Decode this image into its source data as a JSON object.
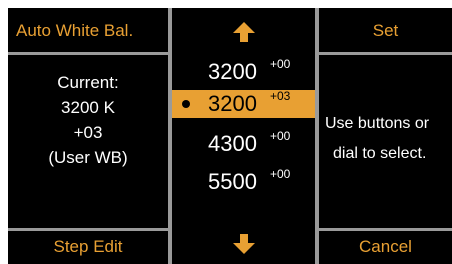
{
  "left": {
    "header": "Auto White Bal.",
    "current_label": "Current:",
    "current_temp": "3200 K",
    "current_offset": "+03",
    "current_mode": "(User WB)",
    "footer": "Step Edit"
  },
  "middle": {
    "up_icon": "arrow-up-icon",
    "down_icon": "arrow-down-icon",
    "items": [
      {
        "value": "3200",
        "offset": "+00",
        "selected": false
      },
      {
        "value": "3200",
        "offset": "+03",
        "selected": true
      },
      {
        "value": "4300",
        "offset": "+00",
        "selected": false
      },
      {
        "value": "5500",
        "offset": "+00",
        "selected": false
      }
    ]
  },
  "right": {
    "header": "Set",
    "hint_line1": "Use buttons or",
    "hint_line2": "dial to select.",
    "footer": "Cancel"
  },
  "colors": {
    "accent": "#e8a033",
    "background": "#000000",
    "divider": "#9a9a9a",
    "text": "#ffffff"
  }
}
